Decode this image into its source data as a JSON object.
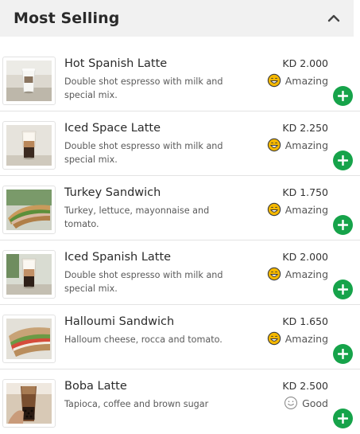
{
  "section": {
    "title": "Most Selling"
  },
  "items": [
    {
      "name": "Hot Spanish Latte",
      "description": "Double shot espresso with milk and special mix.",
      "price": "KD 2.000",
      "rating": "Amazing",
      "rating_icon": "grin-emoji-icon",
      "thumb": "hot-latte-cup-image"
    },
    {
      "name": "Iced Space Latte",
      "description": "Double shot espresso with milk and special mix.",
      "price": "KD 2.250",
      "rating": "Amazing",
      "rating_icon": "grin-emoji-icon",
      "thumb": "iced-latte-glass-image"
    },
    {
      "name": "Turkey Sandwich",
      "description": "Turkey, lettuce, mayonnaise and tomato.",
      "price": "KD 1.750",
      "rating": "Amazing",
      "rating_icon": "grin-emoji-icon",
      "thumb": "turkey-sandwich-image"
    },
    {
      "name": "Iced Spanish Latte",
      "description": "Double shot espresso with milk and special mix.",
      "price": "KD 2.000",
      "rating": "Amazing",
      "rating_icon": "grin-emoji-icon",
      "thumb": "iced-spanish-latte-image"
    },
    {
      "name": "Halloumi Sandwich",
      "description": "Halloum cheese, rocca and tomato.",
      "price": "KD 1.650",
      "rating": "Amazing",
      "rating_icon": "grin-emoji-icon",
      "thumb": "halloumi-sandwich-image"
    },
    {
      "name": "Boba Latte",
      "description": "Tapioca, coffee and brown sugar",
      "price": "KD 2.500",
      "rating": "Good",
      "rating_icon": "smile-outline-icon",
      "thumb": "boba-latte-image"
    }
  ],
  "colors": {
    "accent_green": "#16a34a",
    "emoji_yellow": "#f5b800",
    "header_bg": "#f1f1f1"
  }
}
